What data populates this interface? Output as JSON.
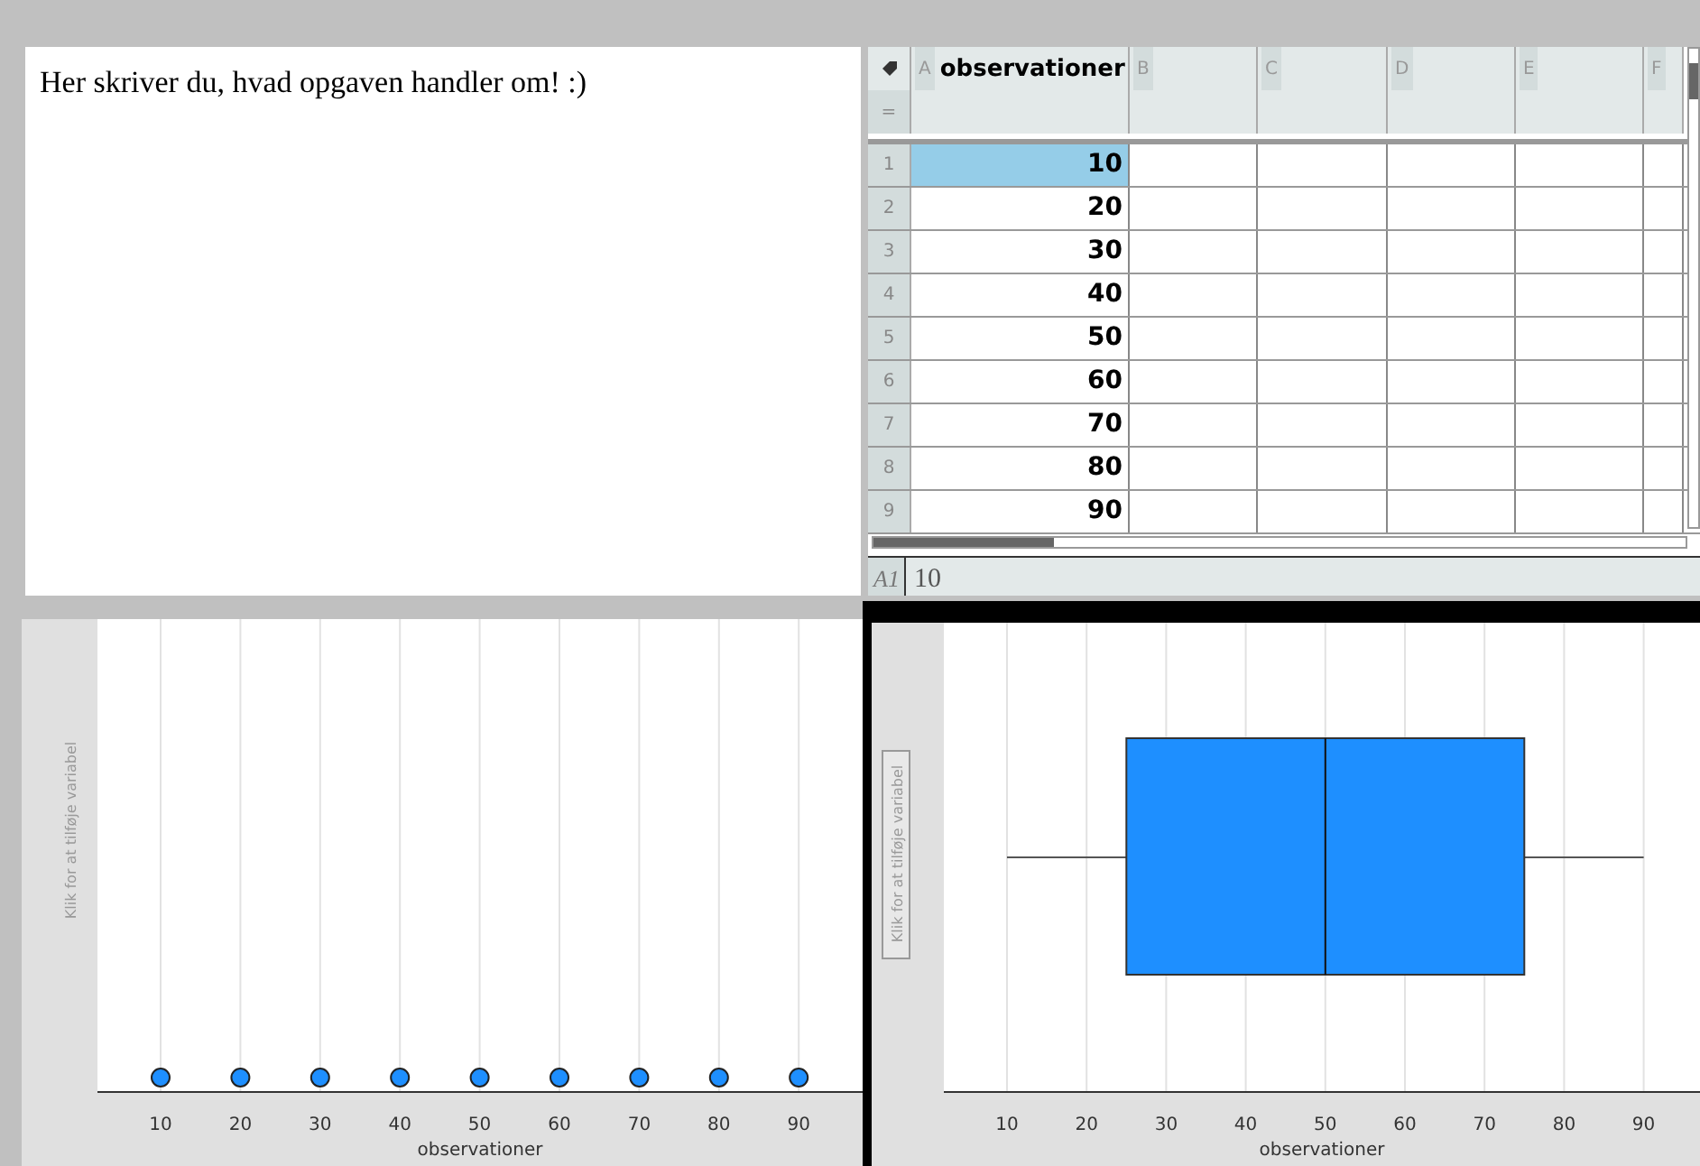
{
  "notes": {
    "text": "Her skriver du, hvad opgaven handler om! :)"
  },
  "spreadsheet": {
    "columns": [
      {
        "letter": "A",
        "name": "observationer"
      },
      {
        "letter": "B"
      },
      {
        "letter": "C"
      },
      {
        "letter": "D"
      },
      {
        "letter": "E"
      },
      {
        "letter": "F"
      }
    ],
    "rows": [
      {
        "number": "1",
        "value": "10",
        "selected": true
      },
      {
        "number": "2",
        "value": "20",
        "selected": false
      },
      {
        "number": "3",
        "value": "30",
        "selected": false
      },
      {
        "number": "4",
        "value": "40",
        "selected": false
      },
      {
        "number": "5",
        "value": "50",
        "selected": false
      },
      {
        "number": "6",
        "value": "60",
        "selected": false
      },
      {
        "number": "7",
        "value": "70",
        "selected": false
      },
      {
        "number": "8",
        "value": "80",
        "selected": false
      },
      {
        "number": "9",
        "value": "90",
        "selected": false
      }
    ],
    "formula_row_symbol": "=",
    "formula_bar": {
      "cell": "A1",
      "value": "10"
    }
  },
  "dot_plot": {
    "y_prompt": "Klik for at tilføje variabel",
    "x_axis": {
      "title": "observationer",
      "ticks": [
        {
          "label": "10",
          "dot": true
        },
        {
          "label": "20",
          "dot": true
        },
        {
          "label": "30",
          "dot": true
        },
        {
          "label": "40",
          "dot": true
        },
        {
          "label": "50",
          "dot": true
        },
        {
          "label": "60",
          "dot": true
        },
        {
          "label": "70",
          "dot": true
        },
        {
          "label": "80",
          "dot": true
        },
        {
          "label": "90",
          "dot": true
        }
      ]
    }
  },
  "box_plot": {
    "selected": true,
    "y_prompt": "Klik for at tilføje variabel",
    "x_axis": {
      "title": "observationer",
      "ticks": [
        "10",
        "20",
        "30",
        "40",
        "50",
        "60",
        "70",
        "80",
        "90"
      ]
    }
  }
}
